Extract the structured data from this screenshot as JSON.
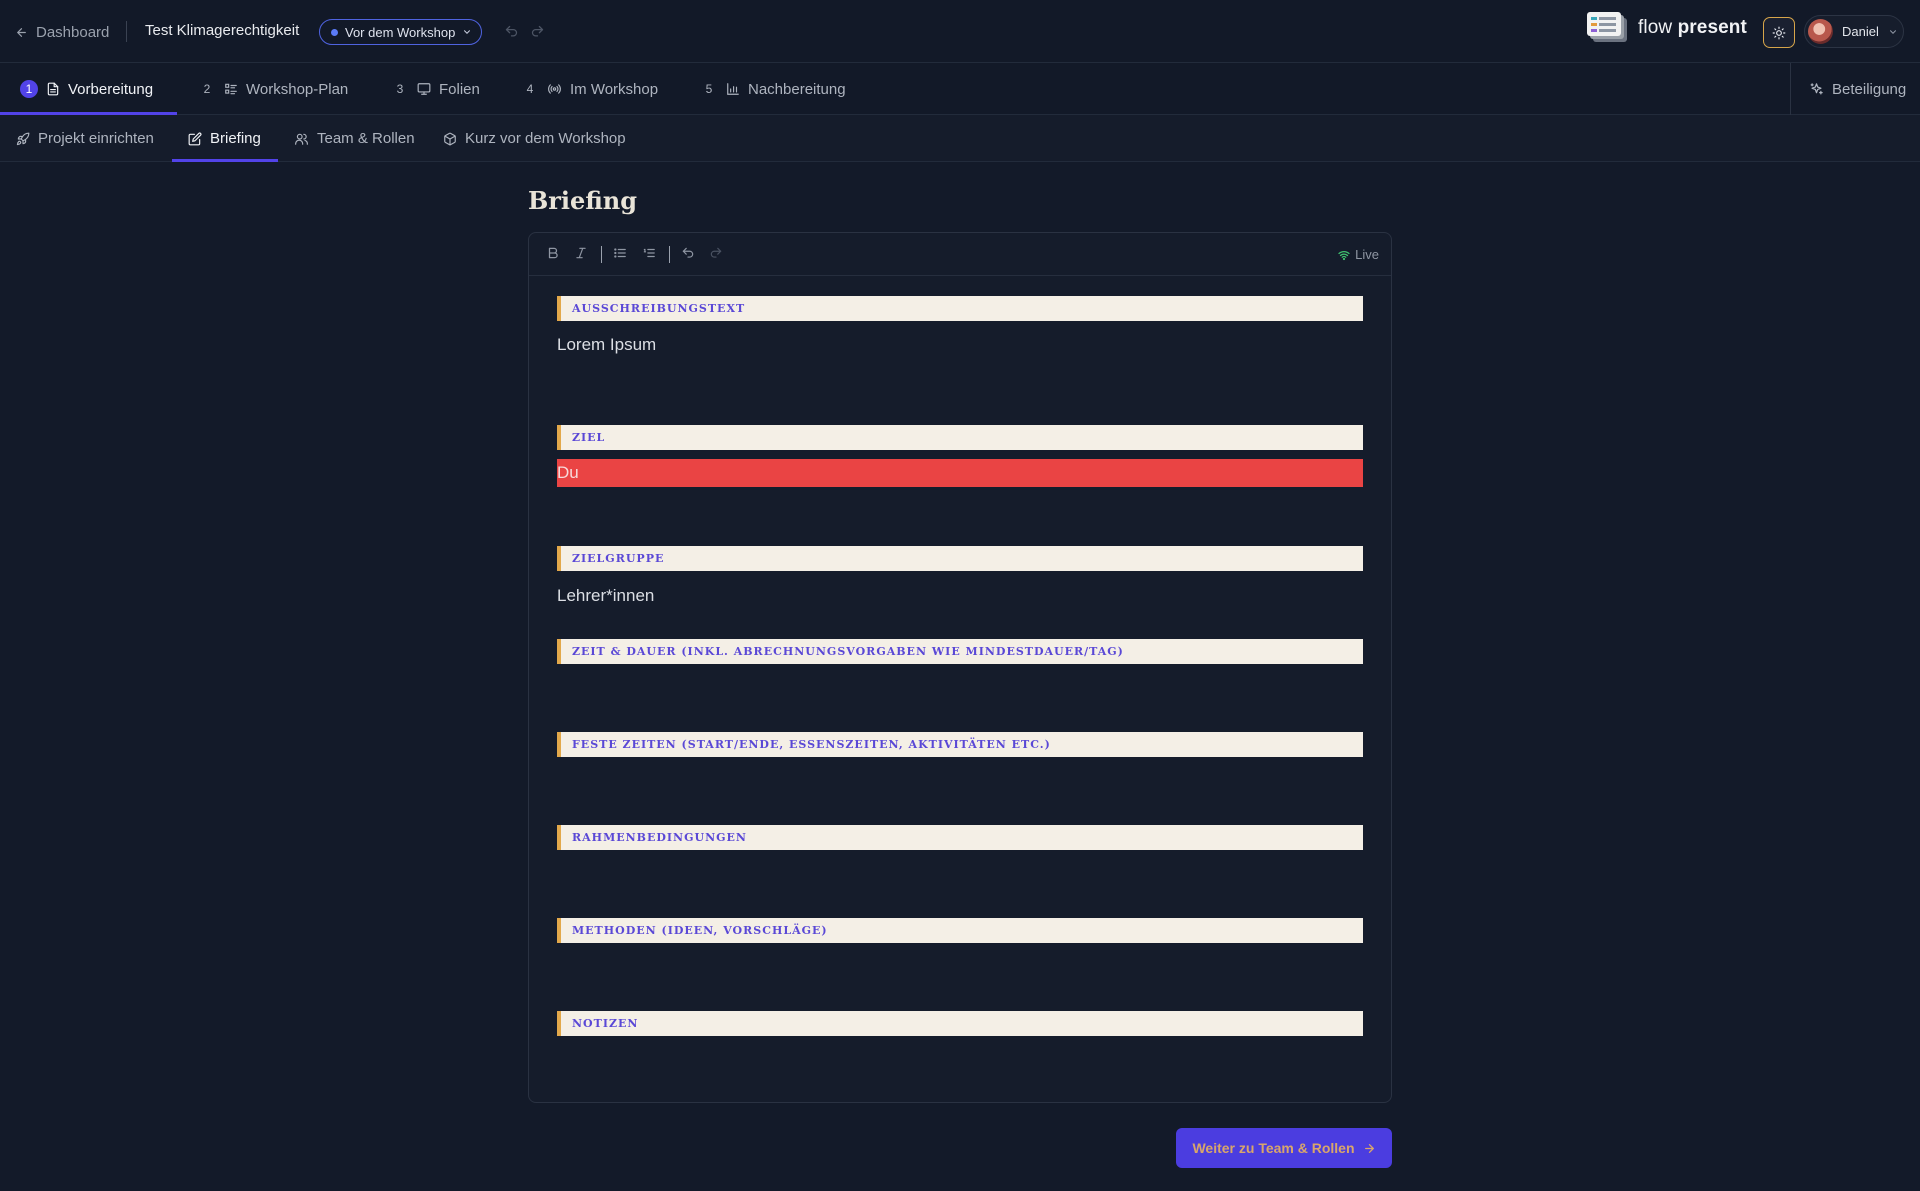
{
  "header": {
    "back_label": "Dashboard",
    "project_title": "Test Klimagerechtigkeit",
    "phase_status": "Vor dem Workshop",
    "logo": {
      "word1": "flow",
      "word2": "present"
    },
    "user_name": "Daniel"
  },
  "phase_tabs": [
    {
      "num": "1",
      "label": "Vorbereitung",
      "icon": "document-icon",
      "active": true
    },
    {
      "num": "2",
      "label": "Workshop-Plan",
      "icon": "list-icon",
      "active": false
    },
    {
      "num": "3",
      "label": "Folien",
      "icon": "presentation-icon",
      "active": false
    },
    {
      "num": "4",
      "label": "Im Workshop",
      "icon": "broadcast-icon",
      "active": false
    },
    {
      "num": "5",
      "label": "Nachbereitung",
      "icon": "bar-chart-icon",
      "active": false
    }
  ],
  "beteiligung_label": "Beteiligung",
  "sub_tabs": [
    {
      "label": "Projekt einrichten",
      "icon": "rocket-icon",
      "active": false
    },
    {
      "label": "Briefing",
      "icon": "edit-icon",
      "active": true
    },
    {
      "label": "Team & Rollen",
      "icon": "users-icon",
      "active": false
    },
    {
      "label": "Kurz vor dem Workshop",
      "icon": "package-icon",
      "active": false
    }
  ],
  "page_title": "Briefing",
  "editor": {
    "live_label": "Live",
    "sections": [
      {
        "label": "Ausschreibungstext",
        "content": "Lorem Ipsum"
      },
      {
        "label": "Ziel",
        "content": "Du"
      },
      {
        "label": "Zielgruppe",
        "content": "Lehrer*innen"
      },
      {
        "label": "Zeit & Dauer (inkl. Abrechnungsvorgaben wie Mindestdauer/Tag)",
        "content": ""
      },
      {
        "label": "Feste Zeiten (Start/Ende, Essenszeiten, Aktivitäten etc.)",
        "content": ""
      },
      {
        "label": "Rahmenbedingungen",
        "content": ""
      },
      {
        "label": "Methoden (Ideen, Vorschläge)",
        "content": ""
      },
      {
        "label": "Notizen",
        "content": ""
      }
    ]
  },
  "next_button_label": "Weiter zu Team & Rollen",
  "colors": {
    "accent": "#5243e8",
    "highlight": "#ea4444",
    "label_bar": "#e2a84b",
    "background": "#131a29"
  }
}
